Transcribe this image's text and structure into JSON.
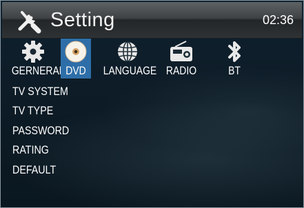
{
  "header": {
    "title": "Setting",
    "time": "02:36"
  },
  "tabs": [
    {
      "label": "GERNERAL",
      "icon": "gear-icon",
      "selected": false
    },
    {
      "label": "DVD",
      "icon": "disc-icon",
      "selected": true
    },
    {
      "label": "LANGUAGE",
      "icon": "globe-icon",
      "selected": false
    },
    {
      "label": "RADIO",
      "icon": "radio-icon",
      "selected": false
    },
    {
      "label": "BT",
      "icon": "bluetooth-icon",
      "selected": false
    }
  ],
  "menu": {
    "items": [
      "TV SYSTEM",
      "TV TYPE",
      "PASSWORD",
      "RATING",
      "DEFAULT"
    ]
  },
  "colors": {
    "active_tab": "#2e6ea8",
    "title_bar": "#3e4244"
  }
}
